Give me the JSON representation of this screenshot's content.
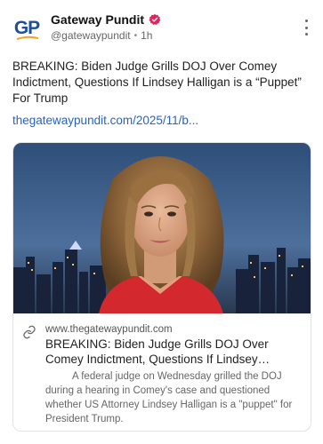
{
  "post": {
    "author_initials": "GP",
    "author_name": "Gateway Pundit",
    "handle": "@gatewaypundit",
    "separator": "•",
    "time": "1h",
    "body": "BREAKING: Biden Judge Grills DOJ Over Comey Indictment, Questions If Lindsey Halligan is a “Puppet” For Trump",
    "link_text": "thegatewaypundit.com/2025/11/b..."
  },
  "link_card": {
    "domain": "www.thegatewaypundit.com",
    "title": "BREAKING: Biden Judge Grills DOJ Over Comey Indictment, Questions If Lindsey Halligan is a \"...",
    "description": "A federal judge on Wednesday grilled the DOJ during a hearing in Comey's case and questioned whether US Attorney Lindsey Halligan is a \"puppet\" for President Trump."
  },
  "colors": {
    "link": "#2463c9",
    "verified": "#e0245e",
    "logo": "#1d4f9c"
  },
  "icons": {
    "verified": "verified-badge-icon",
    "more": "more-vertical-icon",
    "link": "chain-link-icon"
  }
}
